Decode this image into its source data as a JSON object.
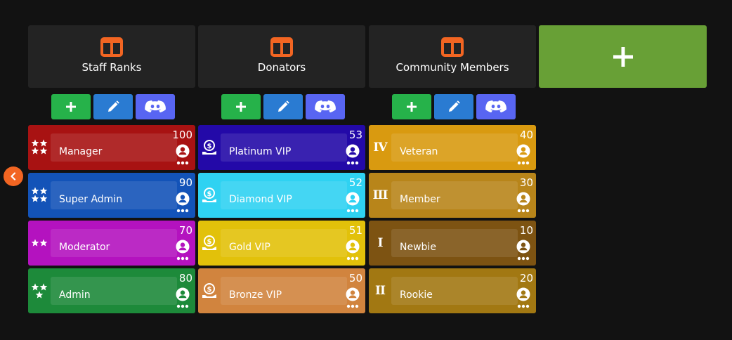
{
  "colors": {
    "accent": "#f26522",
    "background": "#121212",
    "category_bg": "#232323",
    "add_category_bg": "#68a036",
    "add_button": "#26b24a",
    "edit_button": "#2a7bd2",
    "discord_button": "#5865f2"
  },
  "add_category": {
    "icon": "plus-icon"
  },
  "categories": [
    {
      "title": "Staff Ranks",
      "icon": "columns-icon",
      "toolbar": {
        "add_icon": "plus-icon",
        "edit_icon": "pencil-icon",
        "discord_icon": "discord-icon"
      },
      "ranks": [
        {
          "name": "Manager",
          "count": "100",
          "color": "#a81212",
          "badge": "stars-4-icon"
        },
        {
          "name": "Super Admin",
          "count": "90",
          "color": "#1353b8",
          "badge": "stars-4-icon"
        },
        {
          "name": "Moderator",
          "count": "70",
          "color": "#b412bf",
          "badge": "stars-2-icon"
        },
        {
          "name": "Admin",
          "count": "80",
          "color": "#1d8a3a",
          "badge": "stars-3-icon"
        }
      ]
    },
    {
      "title": "Donators",
      "icon": "columns-icon",
      "toolbar": {
        "add_icon": "plus-icon",
        "edit_icon": "pencil-icon",
        "discord_icon": "discord-icon"
      },
      "ranks": [
        {
          "name": "Platinum VIP",
          "count": "53",
          "color": "#2309a8",
          "badge": "money-hand-icon"
        },
        {
          "name": "Diamond VIP",
          "count": "52",
          "color": "#2fd2f2",
          "badge": "money-hand-icon"
        },
        {
          "name": "Gold VIP",
          "count": "51",
          "color": "#e2c10a",
          "badge": "money-hand-icon"
        },
        {
          "name": "Bronze VIP",
          "count": "50",
          "color": "#d1843e",
          "badge": "money-hand-icon"
        }
      ]
    },
    {
      "title": "Community Members",
      "icon": "columns-icon",
      "toolbar": {
        "add_icon": "plus-icon",
        "edit_icon": "pencil-icon",
        "discord_icon": "discord-icon"
      },
      "ranks": [
        {
          "name": "Veteran",
          "count": "40",
          "color": "#d99a10",
          "badge": "roman-iv-icon",
          "badge_text": "IV"
        },
        {
          "name": "Member",
          "count": "30",
          "color": "#b8851a",
          "badge": "roman-iii-icon",
          "badge_text": "III"
        },
        {
          "name": "Newbie",
          "count": "10",
          "color": "#7d5312",
          "badge": "roman-i-icon",
          "badge_text": "I"
        },
        {
          "name": "Rookie",
          "count": "20",
          "color": "#a27812",
          "badge": "roman-ii-icon",
          "badge_text": "II"
        }
      ]
    }
  ],
  "collapse": {
    "icon": "chevron-left-icon"
  }
}
